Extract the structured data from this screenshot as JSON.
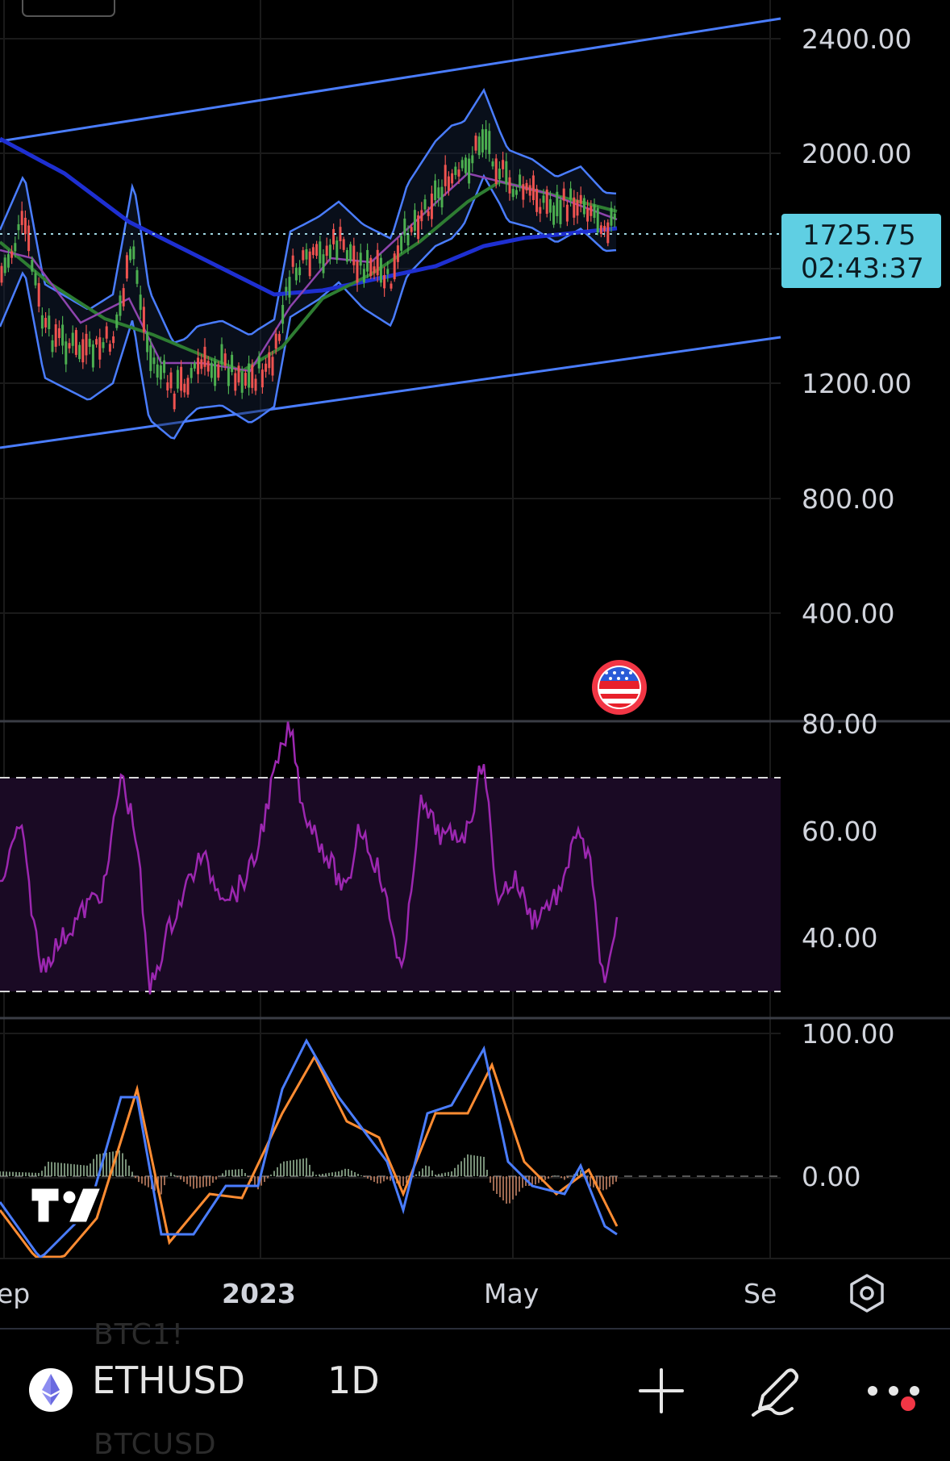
{
  "price_axis": {
    "labels": [
      "2400.00",
      "2000.00",
      "1200.00",
      "800.00",
      "400.00"
    ],
    "current_price": "1725.75",
    "countdown": "02:43:37",
    "tag_color": "#5fcfe3"
  },
  "rsi_axis": {
    "labels": [
      "80.00",
      "60.00",
      "40.00"
    ]
  },
  "macd_axis": {
    "labels": [
      "100.00",
      "0.00"
    ]
  },
  "time_axis": {
    "labels": [
      "ep",
      "2023",
      "May",
      "Se"
    ]
  },
  "bottom_bar": {
    "ghost_above": "BTC1!",
    "ghost_below": "BTCUSD",
    "symbol": "ETHUSD",
    "interval": "1D",
    "add_icon": "plus-icon",
    "draw_icon": "pen-icon",
    "more_icon": "more-dots-icon",
    "settings_icon": "settings-hexagon-icon"
  },
  "colors": {
    "up": "#4caf50",
    "down": "#ef5350",
    "channel": "#4a7dff",
    "ma_slow": "#1e2fd1",
    "ma_fast": "#2e7d32",
    "rsi": "#9c27b0",
    "macd": "#4a7dff",
    "signal": "#ff8c32",
    "notification_dot": "#f23645"
  }
}
